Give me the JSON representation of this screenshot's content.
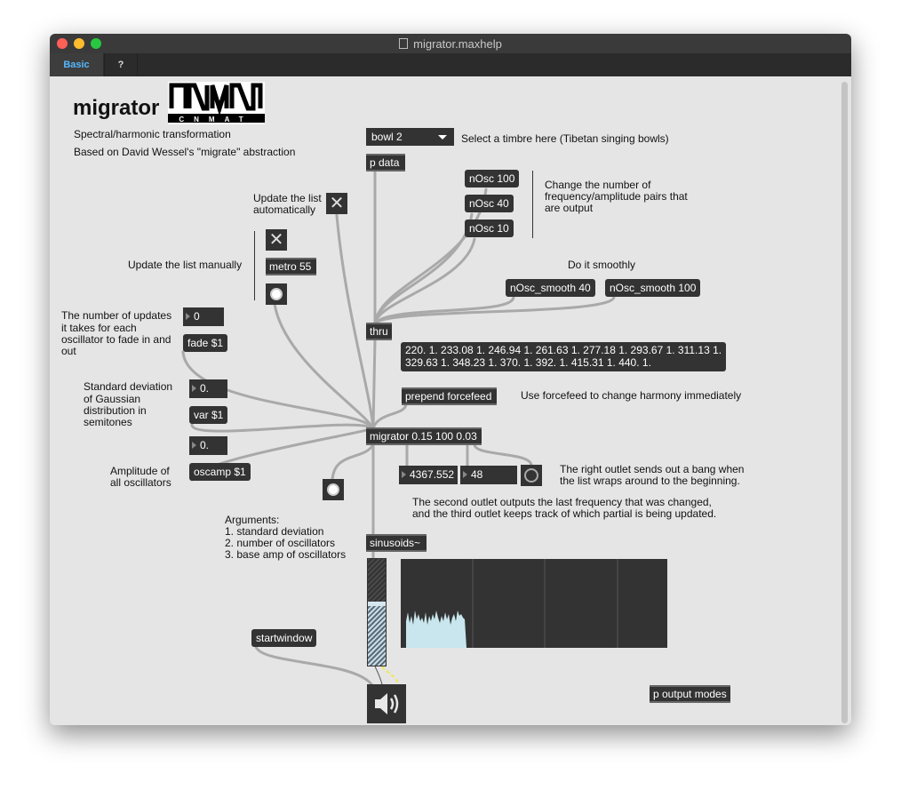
{
  "window": {
    "title": "migrator.maxhelp"
  },
  "tabs": [
    "Basic",
    "?"
  ],
  "header": {
    "title": "migrator",
    "logo_text": "CNMAT",
    "subtitle": "Spectral/harmonic transformation",
    "based_on": "Based on David Wessel's \"migrate\" abstraction"
  },
  "menu": {
    "value": "bowl 2",
    "comment": "Select a timbre here (Tibetan singing bowls)"
  },
  "objects": {
    "p_data": "p data",
    "metro": "metro 55",
    "thru": "thru",
    "prepend": "prepend forcefeed",
    "migrator": "migrator 0.15 100 0.03",
    "sinusoids": "sinusoids~",
    "p_output": "p output modes"
  },
  "messages": {
    "nosc100": "nOsc 100",
    "nosc40": "nOsc 40",
    "nosc10": "nOsc 10",
    "smooth40": "nOsc_smooth 40",
    "smooth100": "nOsc_smooth 100",
    "fade": "fade $1",
    "var": "var $1",
    "oscamp": "oscamp $1",
    "list_line1": "220. 1. 233.08 1. 246.94 1. 261.63 1. 277.18 1. 293.67 1. 311.13 1.",
    "list_line2": "329.63 1. 348.23 1. 370. 1. 392. 1. 415.31 1. 440. 1.",
    "startwindow": "startwindow"
  },
  "numbers": {
    "fade_in": "0",
    "var_in": "0.",
    "amp_in": "0.",
    "freq_out": "4367.552",
    "partial_out": "48"
  },
  "comments": {
    "update_auto_1": "Update the list",
    "update_auto_2": "automatically",
    "update_manual": "Update the list manually",
    "nosc_1": "Change the number of",
    "nosc_2": "frequency/amplitude pairs that",
    "nosc_3": "are output",
    "smooth": "Do it smoothly",
    "fade_1": "The number of updates",
    "fade_2": "it takes for each",
    "fade_3": "oscillator to fade in and",
    "fade_4": "out",
    "std_1": "Standard deviation",
    "std_2": "of Gaussian",
    "std_3": "distribution in",
    "std_4": "semitones",
    "amp_1": "Amplitude of",
    "amp_2": "all oscillators",
    "forcefeed": "Use forcefeed to change harmony immediately",
    "right_outlet_1": "The right outlet sends out a bang when",
    "right_outlet_2": "the list wraps around to the beginning.",
    "second_outlet_1": "The second outlet outputs the last frequency that was changed,",
    "second_outlet_2": "and the third outlet keeps track of which partial is being updated.",
    "args_0": "Arguments:",
    "args_1": "1. standard deviation",
    "args_2": "2. number of oscillators",
    "args_3": "3. base amp of oscillators"
  },
  "colors": {
    "accent": "#55b8ff",
    "object_bg": "#333333",
    "canvas": "#e5e5e5",
    "patch_cord": "#a9a9a9"
  },
  "icons": [
    "close-icon",
    "speaker-icon",
    "chevron-down-icon"
  ]
}
